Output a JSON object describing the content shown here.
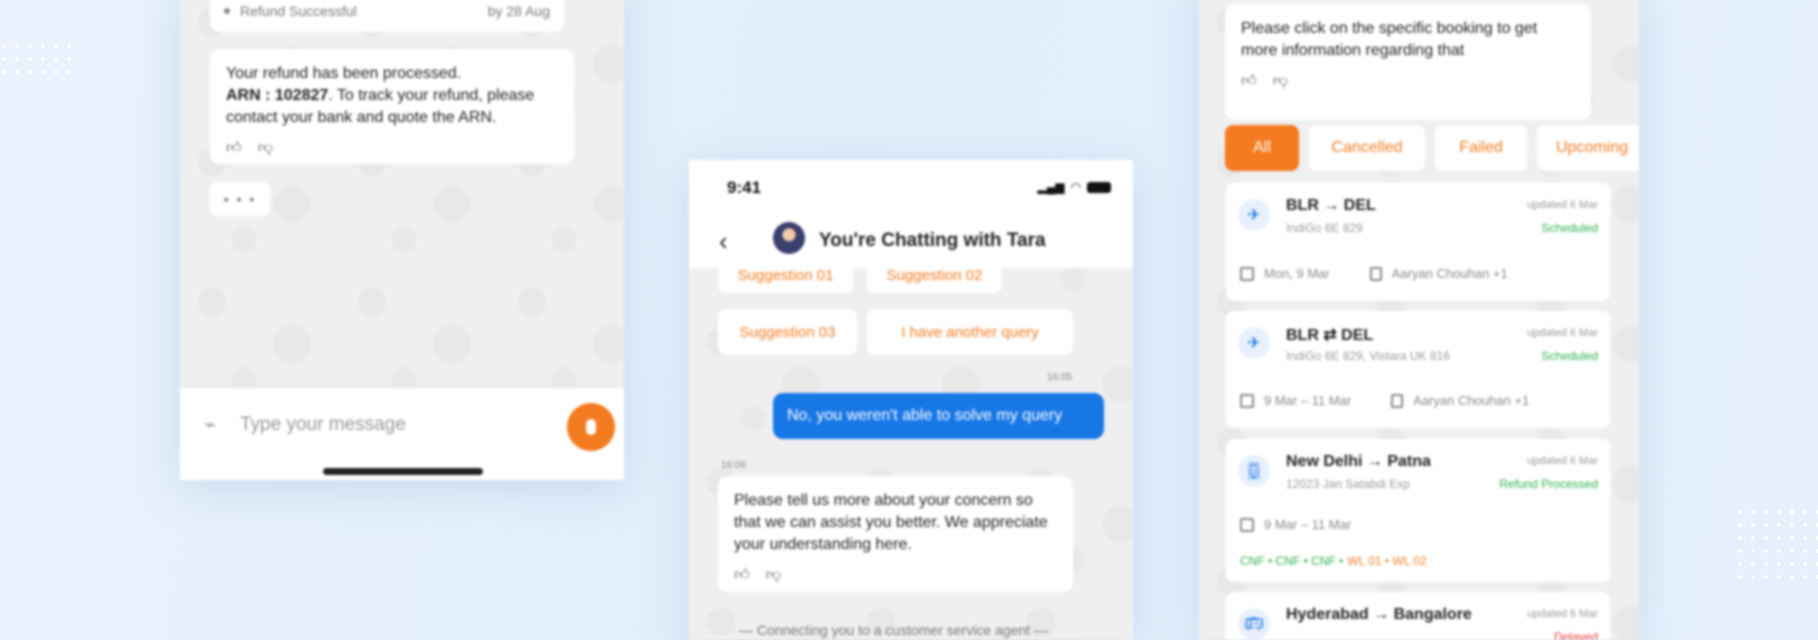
{
  "left_phone": {
    "status_text": "Refund Successful",
    "status_date": "by 28 Aug",
    "refund_message": {
      "line1": "Your refund has been processed.",
      "arn_label": "ARN : 102827",
      "line2": ". To track your refund, please contact your bank and quote the ARN."
    },
    "typing_indicator": "• • •",
    "input_placeholder": "Type your message"
  },
  "mid_phone": {
    "time": "9:41",
    "chat_title": "You're Chatting with Tara",
    "suggestions": [
      "Suggestion 01",
      "Suggestion 02",
      "Suggestion 03",
      "I have another query"
    ],
    "sent_time": "16:05",
    "sent_message": "No, you weren't able to solve my query",
    "recv_time": "16:06",
    "recv_message": "Please tell us more about your concern so that we can assist you better. We appreciate your understanding here.",
    "system_note": "— Connecting you to a customer service agent —"
  },
  "right_phone": {
    "top_message": "Please click on the specific booking to get more information regarding that",
    "filters": [
      "All",
      "Cancelled",
      "Failed",
      "Upcoming"
    ],
    "bookings": [
      {
        "route": "BLR → DEL",
        "sub": "IndiGo 6E 829",
        "updated": "updated 6 Mar",
        "status": "Scheduled",
        "date": "Mon, 9 Mar",
        "passenger": "Aaryan Chouhan +1"
      },
      {
        "route": "BLR ⇄ DEL",
        "sub": "IndiGo 6E 829, Vistara UK 816",
        "updated": "updated 6 Mar",
        "status": "Scheduled",
        "date": "9 Mar – 11 Mar",
        "passenger": "Aaryan Chouhan +1"
      },
      {
        "route": "New Delhi → Patna",
        "sub": "12023 Jan Satabdi Exp",
        "updated": "updated 6 Mar",
        "status": "Refund Processed",
        "date": "9 Mar – 11 Mar",
        "pnr_green": "CNF • CNF • CNF •",
        "pnr_orange": "WL 01 • WL 02"
      },
      {
        "route": "Hyderabad → Bangalore",
        "sub": "",
        "updated": "updated 6 Mar",
        "status": "Delayed"
      }
    ]
  },
  "colors": {
    "accent": "#f47b20",
    "blue": "#1877e6",
    "success": "#2bb24c"
  }
}
